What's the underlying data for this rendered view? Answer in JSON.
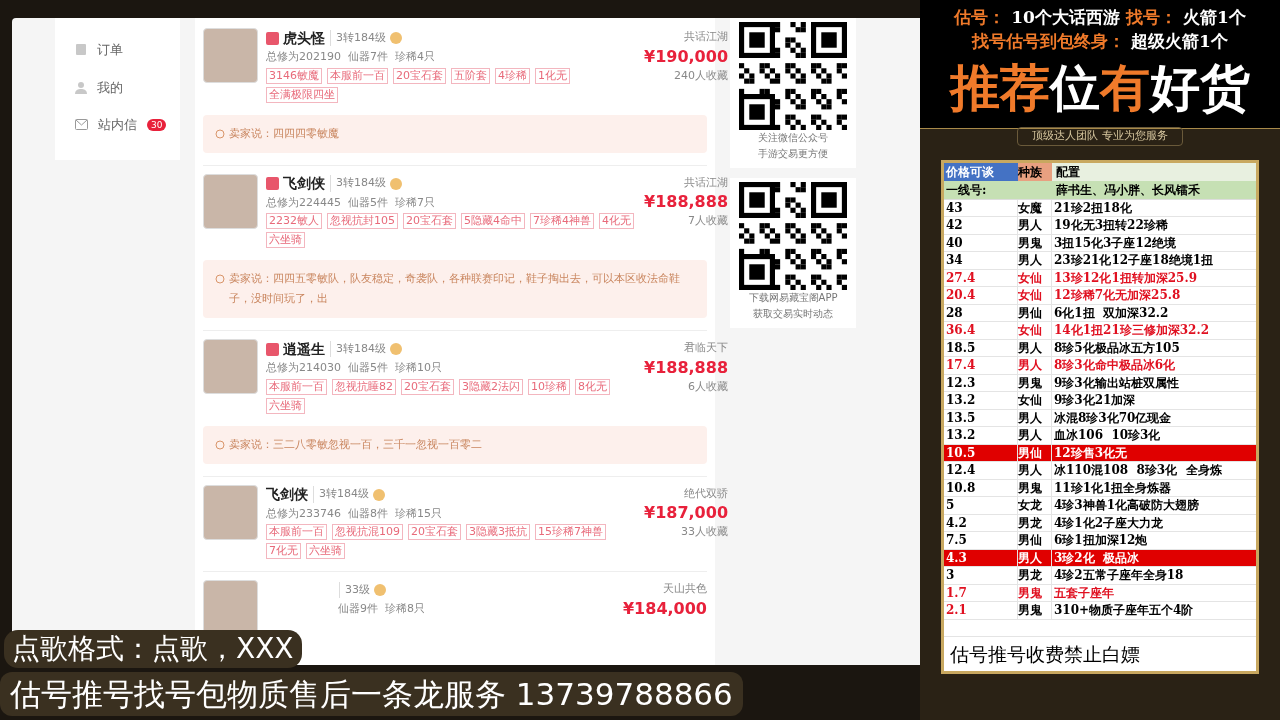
{
  "sidebar": {
    "items": [
      {
        "label": "订单",
        "kind": "order"
      },
      {
        "label": "我的",
        "kind": "user"
      },
      {
        "label": "站内信",
        "kind": "mail",
        "badge": "30"
      }
    ]
  },
  "listings": [
    {
      "tagged": true,
      "name": "虎头怪",
      "level": "3转184级",
      "stats": "总修为202190  仙器7件  珍稀4只",
      "tags": [
        "3146敏魔",
        "本服前一百",
        "20宝石套",
        "五阶套",
        "4珍稀",
        "1化无",
        "全满极限四坐"
      ],
      "server": "共话江湖",
      "price": "¥190,000",
      "favorites": "240人收藏",
      "note": "卖家说：四四四零敏魔"
    },
    {
      "tagged": true,
      "name": "飞剑侠",
      "level": "3转184级",
      "stats": "总修为224445  仙器5件  珍稀7只",
      "tags": [
        "2232敏人",
        "忽视抗封105",
        "20宝石套",
        "5隐藏4命中",
        "7珍稀4神兽",
        "4化无",
        "六坐骑"
      ],
      "server": "共话江湖",
      "price": "¥188,888",
      "favorites": "7人收藏",
      "note": "卖家说：四四五零敏队，队友稳定，奇袭队，各种联赛印记，鞋子掏出去，可以本区收法命鞋子，没时间玩了，出"
    },
    {
      "tagged": true,
      "name": "逍遥生",
      "level": "3转184级",
      "stats": "总修为214030  仙器5件  珍稀10只",
      "tags": [
        "本服前一百",
        "忽视抗睡82",
        "20宝石套",
        "3隐藏2法闪",
        "10珍稀",
        "8化无",
        "六坐骑"
      ],
      "server": "君临天下",
      "price": "¥188,888",
      "favorites": "6人收藏",
      "note": "卖家说：三二八零敏忽视一百，三千一忽视一百零二"
    },
    {
      "tagged": false,
      "name": "飞剑侠",
      "level": "3转184级",
      "stats": "总修为233746  仙器8件  珍稀15只",
      "tags": [
        "本服前一百",
        "忽视抗混109",
        "20宝石套",
        "3隐藏3抵抗",
        "15珍稀7神兽",
        "7化无",
        "六坐骑"
      ],
      "server": "绝代双骄",
      "price": "¥187,000",
      "favorites": "33人收藏"
    },
    {
      "tagged": false,
      "level": "33级",
      "stats": "仙器9件  珍稀8只",
      "server": "天山共色",
      "price": "¥184,000"
    }
  ],
  "qr_cards": [
    {
      "lines": [
        "关注微信公众号",
        "手游交易更方便"
      ]
    },
    {
      "lines": [
        "下载网易藏宝阁APP",
        "获取交易实时动态"
      ]
    }
  ],
  "promo": {
    "lines": [
      [
        {
          "text": "估号：",
          "color": "#f07a2a"
        },
        {
          "text": "10个大话西游",
          "color": "#ffffff"
        },
        {
          "text": "找号：",
          "color": "#f07a2a"
        },
        {
          "text": "火箭1个",
          "color": "#ffffff"
        }
      ],
      [
        {
          "text": "找号估号到包终身：",
          "color": "#f07a2a"
        },
        {
          "text": "超级火箭1个",
          "color": "#ffffff"
        }
      ]
    ],
    "headline": [
      {
        "text": "推荐",
        "color": "#f07a2a"
      },
      {
        "text": "位",
        "color": "#ffffff"
      },
      {
        "text": "有",
        "color": "#f07a2a"
      },
      {
        "text": "好货",
        "color": "#ffffff"
      }
    ],
    "subtitle": "顶级达人团队 专业为您服务"
  },
  "sheet": {
    "headers": [
      "价格可谈",
      "种族",
      "配置"
    ],
    "first_line": {
      "label": "一线号:",
      "value": "薛书生、冯小胖、长风镭禾"
    },
    "rows": [
      {
        "price": "43",
        "race": "女魔",
        "config": "21珍2扭18化",
        "kind": "normal"
      },
      {
        "price": "42",
        "race": "男人",
        "config": "19化无3扭转22珍稀",
        "kind": "normal"
      },
      {
        "price": "40",
        "race": "男鬼",
        "config": "3扭15化3子座12绝境",
        "kind": "normal"
      },
      {
        "price": "34",
        "race": "男人",
        "config": "23珍21化12子座18绝境1扭",
        "kind": "normal"
      },
      {
        "price": "27.4",
        "race": "女仙",
        "config": "13珍12化1扭转加深25.9",
        "kind": "red"
      },
      {
        "price": "20.4",
        "race": "女仙",
        "config": "12珍稀7化无加深25.8",
        "kind": "red"
      },
      {
        "price": "28",
        "race": "男仙",
        "config": "6化1扭  双加深32.2",
        "kind": "normal"
      },
      {
        "price": "36.4",
        "race": "女仙",
        "config": "14化1扭21珍三修加深32.2",
        "kind": "red"
      },
      {
        "price": "18.5",
        "race": "男人",
        "config": "8珍5化极品冰五方105",
        "kind": "normal"
      },
      {
        "price": "17.4",
        "race": "男人",
        "config": "8珍3化命中极品冰6化",
        "kind": "red"
      },
      {
        "price": "12.3",
        "race": "男鬼",
        "config": "9珍3化输出站桩双属性",
        "kind": "normal"
      },
      {
        "price": "13.2",
        "race": "女仙",
        "config": "9珍3化21加深",
        "kind": "normal"
      },
      {
        "price": "13.5",
        "race": "男人",
        "config": "冰混8珍3化70亿现金",
        "kind": "normal"
      },
      {
        "price": "13.2",
        "race": "男人",
        "config": "血冰106  10珍3化",
        "kind": "normal"
      },
      {
        "price": "10.5",
        "race": "男仙",
        "config": "12珍售3化无",
        "kind": "highlight"
      },
      {
        "price": "12.4",
        "race": "男人",
        "config": "冰110混108  8珍3化  全身炼",
        "kind": "normal"
      },
      {
        "price": "10.8",
        "race": "男鬼",
        "config": "11珍1化1扭全身炼器",
        "kind": "normal"
      },
      {
        "price": "5",
        "race": "女龙",
        "config": "4珍3神兽1化高破防大翅膀",
        "kind": "normal"
      },
      {
        "price": "4.2",
        "race": "男龙",
        "config": "4珍1化2子座大力龙",
        "kind": "normal"
      },
      {
        "price": "7.5",
        "race": "男仙",
        "config": "6珍1扭加深12炮",
        "kind": "normal"
      },
      {
        "price": "4.3",
        "race": "男人",
        "config": "3珍2化  极品冰",
        "kind": "highlight"
      },
      {
        "price": "3",
        "race": "男龙",
        "config": "4珍2五常子座年全身18",
        "kind": "normal"
      },
      {
        "price": "1.7",
        "race": "男鬼",
        "config": "五套子座年",
        "kind": "red"
      },
      {
        "price": "2.1",
        "race": "男鬼",
        "config": "310+物质子座年五个4阶",
        "kind": "red-price"
      }
    ],
    "footer": "估号推号收费禁止白嫖"
  },
  "overlay": {
    "song_format": "点歌格式：点歌，XXX",
    "service": "估号推号找号包物质售后一条龙服务 13739788866"
  }
}
